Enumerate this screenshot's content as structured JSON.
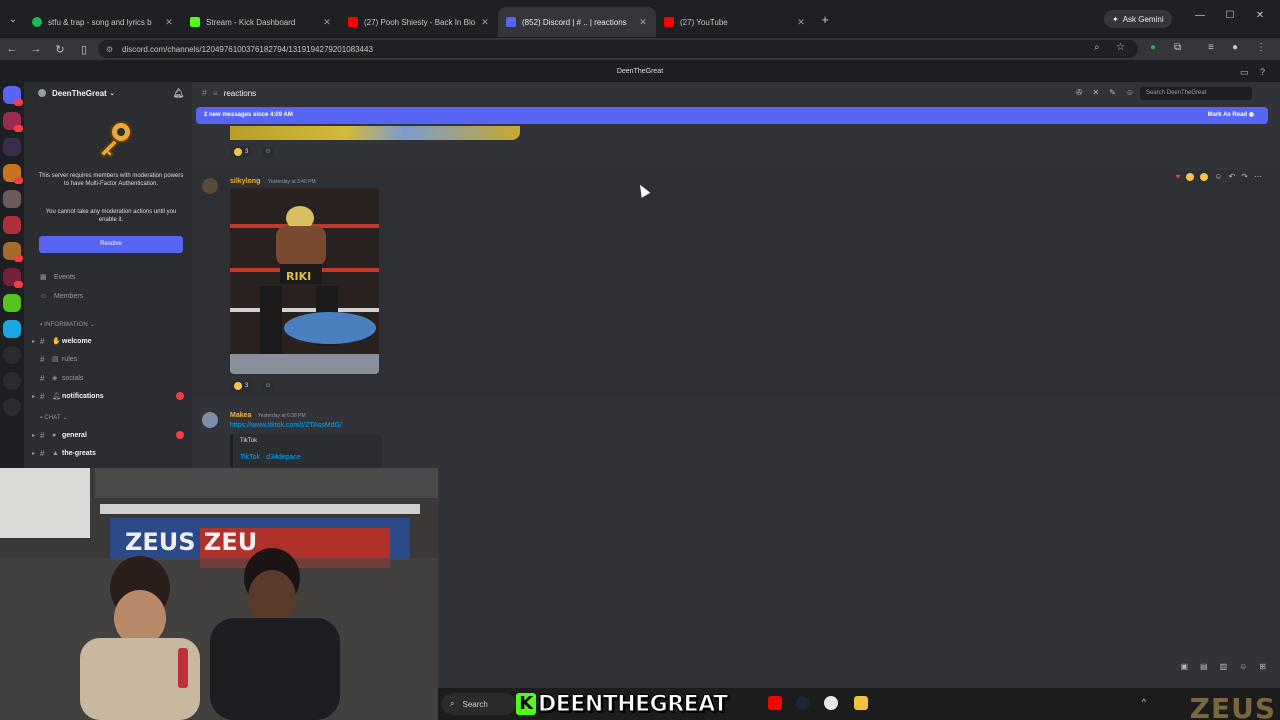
{
  "browser": {
    "tabs": [
      {
        "title": "stfu & trap - song and lyrics b",
        "color": "#1db954",
        "active": false
      },
      {
        "title": "Stream - Kick Dashboard",
        "color": "#53fc18",
        "active": false
      },
      {
        "title": "(27) Pooh Shiesty - Back In Blo",
        "color": "#ff0000",
        "active": false
      },
      {
        "title": "(852) Discord | # .. | reactions",
        "color": "#5865f2",
        "active": true
      },
      {
        "title": "(27) YouTube",
        "color": "#ff0000",
        "active": false
      }
    ],
    "gemini_label": "Ask Gemini",
    "url": "discord.com/channels/1204976100376182794/1319194279201083443"
  },
  "discord": {
    "window_title": "DeenTheGreat",
    "server_name": "DeenTheGreat",
    "mfa_notice": "This server requires members with moderation powers to have Multi-Factor Authentication.",
    "mfa_notice2": "You cannot take any moderation actions until you enable it.",
    "resolve_label": "Resolve",
    "nav_items": [
      {
        "label": "Events",
        "icon": "calendar-icon"
      },
      {
        "label": "Members",
        "icon": "members-icon"
      }
    ],
    "category_info": "INFORMATION",
    "category_chat": "CHAT",
    "channels_info": [
      {
        "name": "welcome",
        "bright": true
      },
      {
        "name": "rules",
        "bright": false
      },
      {
        "name": "socials",
        "bright": false
      },
      {
        "name": "notifications",
        "bright": true,
        "mention": true
      }
    ],
    "channels_chat": [
      {
        "name": "general",
        "bright": true,
        "mention": true
      },
      {
        "name": "the-greats",
        "bright": true
      }
    ],
    "channel_name": "reactions",
    "search_placeholder": "Search DeenTheGreat",
    "new_messages_banner": "2 new messages since 4:09 AM",
    "mark_as_read": "Mark As Read",
    "messages": [
      {
        "author": "silkylong",
        "timestamp": "Yesterday at 3:40 PM",
        "author_color": "#f0b232",
        "reaction_count": "3"
      },
      {
        "author": "Makea",
        "timestamp": "Yesterday at 6:38 PM",
        "author_color": "#f0b232",
        "link": "https://www.tiktok.com/t/ZTAssMdG/",
        "embed_provider": "TikTok",
        "embed_title": "TikTok · d34depace"
      }
    ],
    "top_reaction_count": "3"
  },
  "taskbar": {
    "search_label": "Search",
    "brand_text": "DEENTHEGREAT",
    "brand_k": "K",
    "watermark": "ZEUS"
  }
}
